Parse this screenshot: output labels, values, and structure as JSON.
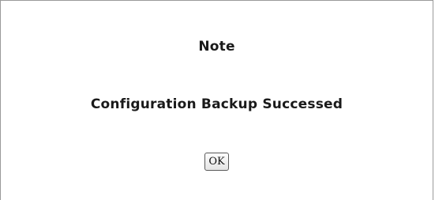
{
  "dialog": {
    "title": "Note",
    "message": "Configuration Backup Successed",
    "ok_label": "OK"
  }
}
